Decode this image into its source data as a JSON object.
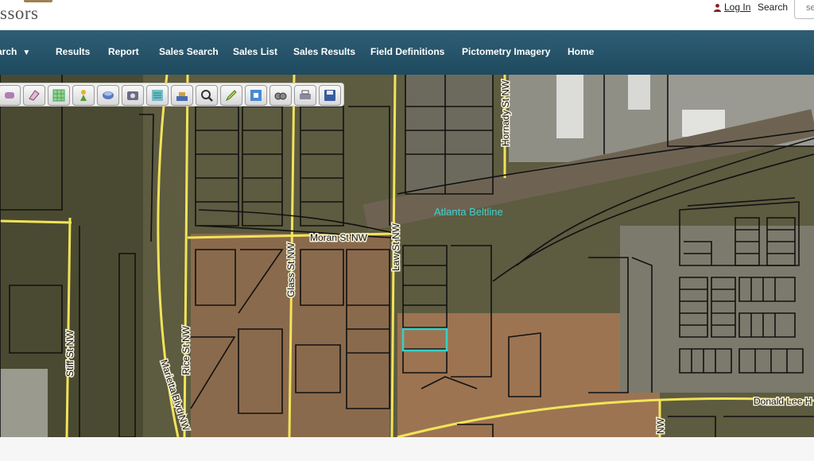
{
  "header": {
    "logo_text": "ssors",
    "login_label": "Log In",
    "search_label": "Search",
    "search_placeholder": "se"
  },
  "nav": {
    "items": [
      {
        "label": "arch",
        "has_dropdown": true
      },
      {
        "label": "Results"
      },
      {
        "label": "Report"
      },
      {
        "label": "Sales Search"
      },
      {
        "label": "Sales List"
      },
      {
        "label": "Sales Results"
      },
      {
        "label": "Field Definitions"
      },
      {
        "label": "Pictometry Imagery"
      },
      {
        "label": "Home"
      }
    ]
  },
  "toolbar": {
    "tools": [
      {
        "icon": "pan-icon"
      },
      {
        "icon": "eraser-icon"
      },
      {
        "icon": "grid-select-icon"
      },
      {
        "icon": "identify-icon"
      },
      {
        "icon": "layers-icon"
      },
      {
        "icon": "camera-icon"
      },
      {
        "icon": "legend-icon"
      },
      {
        "icon": "buffer-icon"
      },
      {
        "icon": "zoom-icon"
      },
      {
        "icon": "draw-icon"
      },
      {
        "icon": "fullscreen-icon"
      },
      {
        "icon": "measure-icon"
      },
      {
        "icon": "print-icon"
      },
      {
        "icon": "save-icon"
      }
    ]
  },
  "map": {
    "labels": {
      "beltline": "Atlanta Beltline",
      "moran": "Moran St NW",
      "law": "Law St NW",
      "glass": "Glass St NW",
      "hornady": "Hornady St NW",
      "rice": "Rice St NW",
      "marietta": "Marietta Blvd NW",
      "stiff": "Stiff St NW",
      "donald": "Donald Lee H"
    },
    "colors": {
      "road": "#f2e35a",
      "parcel": "#111111",
      "selection": "#35d0c8",
      "beltline_label": "#3fd0d0"
    }
  }
}
